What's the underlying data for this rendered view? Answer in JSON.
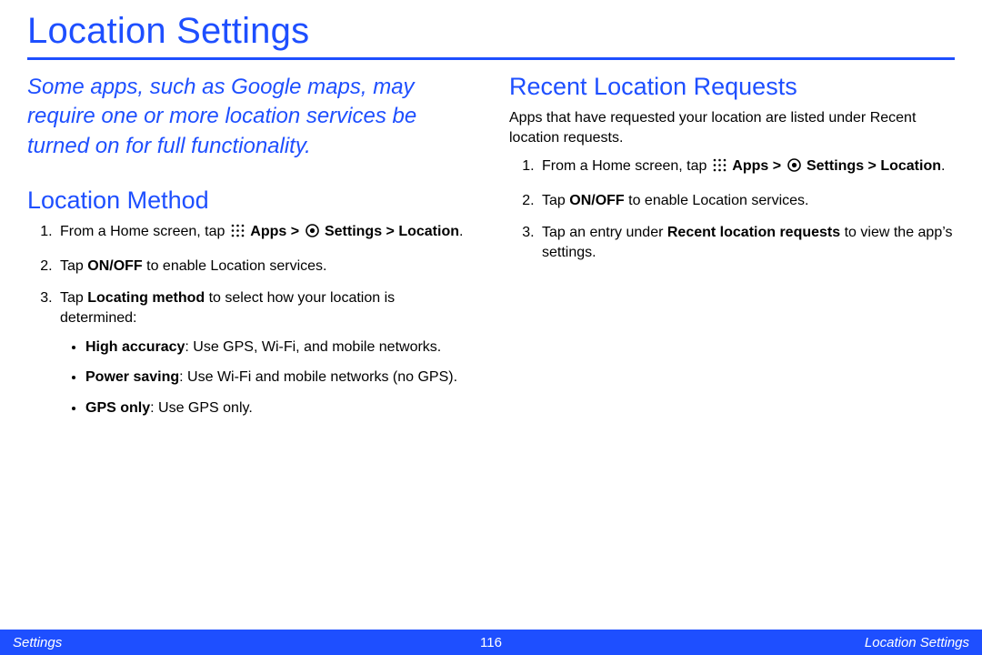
{
  "title": "Location Settings",
  "intro": "Some apps, such as Google maps, may require one or more location services be turned on for full functionality.",
  "left": {
    "heading": "Location Method",
    "step1_pre": "From a Home screen, tap ",
    "apps_label": "Apps > ",
    "settings_label": "Settings > Location",
    "period": ".",
    "step2_pre": "Tap ",
    "step2_b": "ON/OFF",
    "step2_post": " to enable Location services.",
    "step3_pre": "Tap ",
    "step3_b": "Locating method",
    "step3_post": " to select how your location is determined:",
    "opt1_b": "High accuracy",
    "opt1_post": ": Use GPS, Wi-Fi, and mobile networks.",
    "opt2_b": "Power saving",
    "opt2_post": ": Use Wi-Fi and mobile networks (no GPS).",
    "opt3_b": "GPS only",
    "opt3_post": ": Use GPS only."
  },
  "right": {
    "heading": "Recent Location Requests",
    "intro": "Apps that have requested your location are listed under Recent location requests.",
    "step1_pre": "From a Home screen, tap ",
    "apps_label": "Apps > ",
    "settings_label": "Settings > Location",
    "period": ".",
    "step2_pre": "Tap ",
    "step2_b": "ON/OFF",
    "step2_post": " to enable Location services.",
    "step3_pre": "Tap an entry under ",
    "step3_b": "Recent location requests",
    "step3_post": " to view the app’s settings."
  },
  "footer": {
    "left": "Settings",
    "center": "116",
    "right": "Location Settings"
  }
}
